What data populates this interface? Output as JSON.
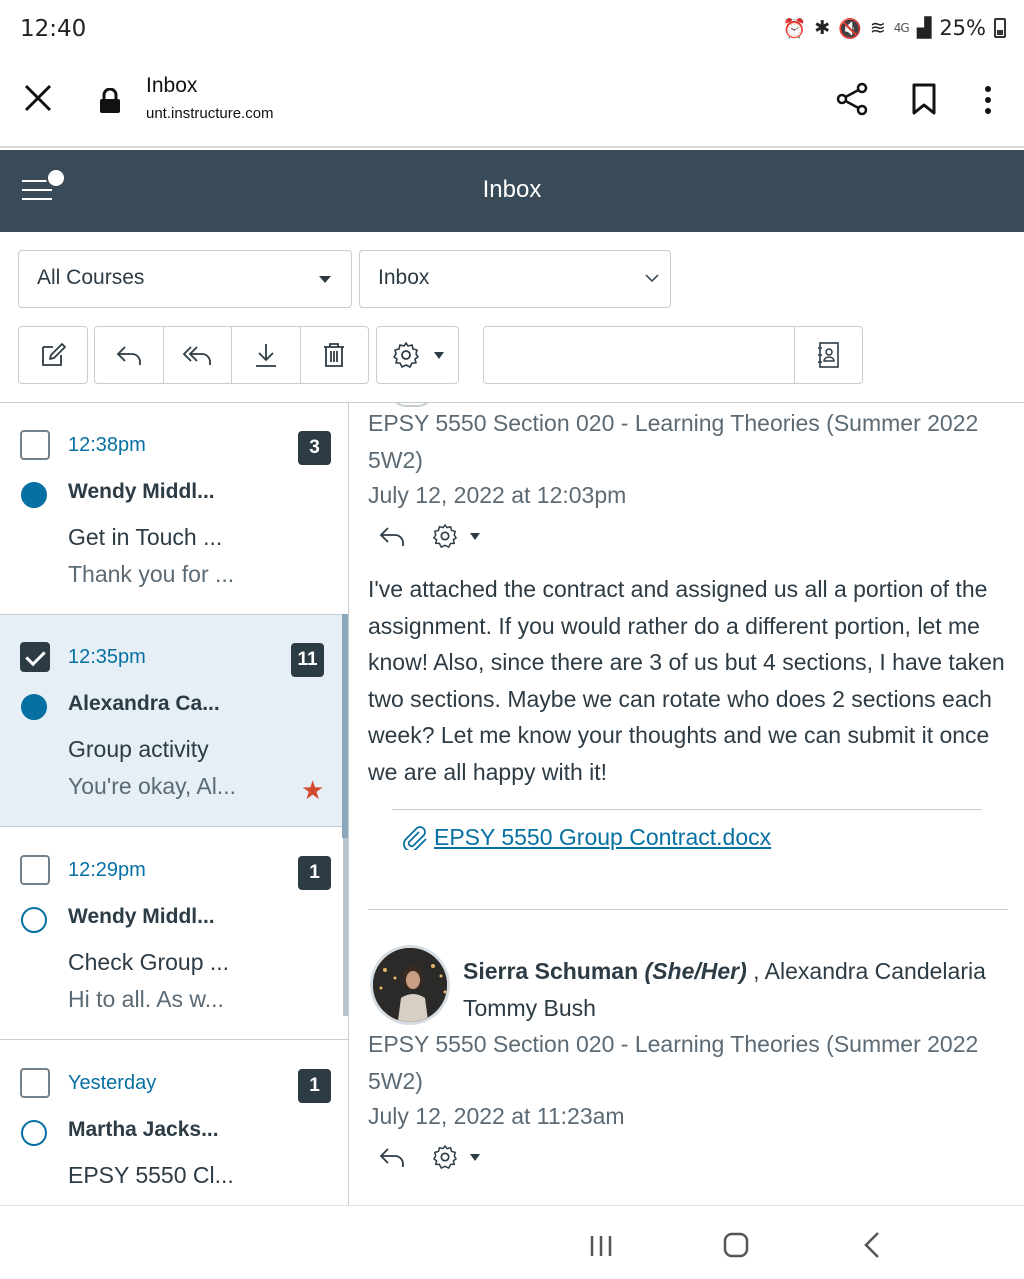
{
  "status_bar": {
    "time": "12:40",
    "network": "4G",
    "battery": "25%"
  },
  "browser": {
    "page_title": "Inbox",
    "url": "unt.instructure.com"
  },
  "header": {
    "title": "Inbox"
  },
  "filters": {
    "course": "All Courses",
    "mailbox": "Inbox"
  },
  "search": {
    "placeholder": ""
  },
  "conversations": [
    {
      "time": "12:38pm",
      "count": "3",
      "author": "Wendy Middl...",
      "subject": "Get in Touch ...",
      "preview": "Thank you for ...",
      "checked": false,
      "unread": true,
      "starred": false
    },
    {
      "time": "12:35pm",
      "count": "11",
      "author": "Alexandra Ca...",
      "subject": "Group activity",
      "preview": "You're okay, Al...",
      "checked": true,
      "unread": true,
      "starred": true
    },
    {
      "time": "12:29pm",
      "count": "1",
      "author": "Wendy Middl...",
      "subject": "Check Group ...",
      "preview": "Hi to all. As w...",
      "checked": false,
      "unread": false,
      "starred": false
    },
    {
      "time": "Yesterday",
      "count": "1",
      "author": "Martha Jacks...",
      "subject": "EPSY 5550 Cl...",
      "preview": "",
      "checked": false,
      "unread": false,
      "starred": false
    }
  ],
  "messages": [
    {
      "course": "EPSY 5550 Section 020 - Learning Theories (Summer 2022 5W2)",
      "date": "July 12, 2022 at 12:03pm",
      "body": "I've attached the contract and assigned us all a portion of the assignment. If you would rather do a different portion, let me know! Also, since there are 3 of us but 4 sections, I have taken two sections. Maybe we can rotate who does 2 sections each week? Let me know your thoughts and we can submit it once we are all happy with it!",
      "attachment": "EPSY 5550 Group Contract.docx"
    },
    {
      "sender": "Sierra Schuman",
      "pronouns": "(She/Her)",
      "others": ", Alexandra Candelaria Tommy Bush",
      "course": "EPSY 5550 Section 020 - Learning Theories (Summer 2022 5W2)",
      "date": "July 12, 2022 at 11:23am"
    }
  ],
  "colors": {
    "header_bg": "#394b58",
    "link_blue": "#0770a3",
    "star_red": "#d14a2f",
    "selected_row": "#e5eff5",
    "badge_bg": "#2d3b45"
  }
}
